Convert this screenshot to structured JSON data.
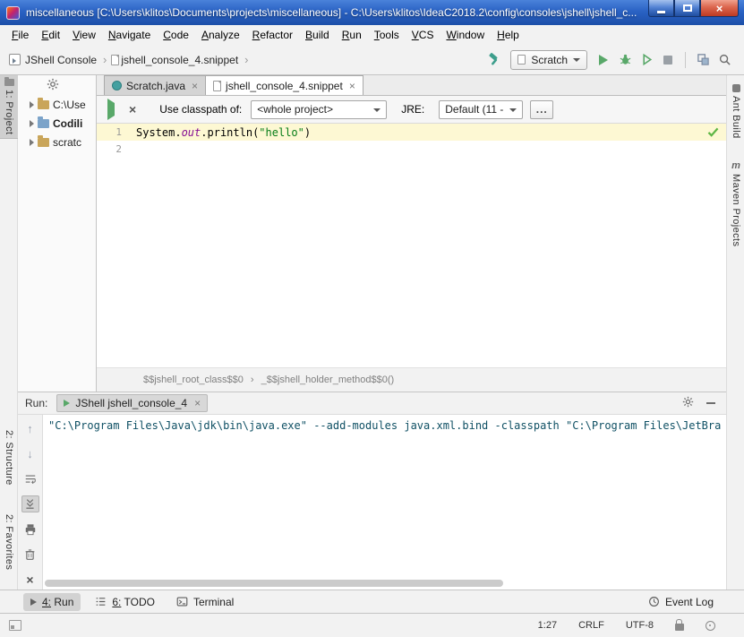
{
  "window": {
    "title": "miscellaneous [C:\\Users\\klitos\\Documents\\projects\\miscellaneous] - C:\\Users\\klitos\\IdeaC2018.2\\config\\consoles\\jshell\\jshell_c..."
  },
  "menu": {
    "items": [
      "File",
      "Edit",
      "View",
      "Navigate",
      "Code",
      "Analyze",
      "Refactor",
      "Build",
      "Run",
      "Tools",
      "VCS",
      "Window",
      "Help"
    ]
  },
  "navbar": {
    "breadcrumb": [
      "JShell Console",
      "jshell_console_4.snippet"
    ],
    "separator": "›",
    "run_config": "Scratch"
  },
  "stripes": {
    "project": "1: Project",
    "structure": "2: Structure",
    "favorites": "2: Favorites",
    "ant": "Ant Build",
    "maven": "Maven Projects"
  },
  "project_tree": {
    "items": [
      "C:\\Use",
      "Codili",
      "scratc"
    ]
  },
  "editor_tabs": {
    "tab1": "Scratch.java",
    "tab2": "jshell_console_4.snippet"
  },
  "jshell_bar": {
    "classpath_label": "Use classpath of:",
    "classpath_value": "<whole project>",
    "jre_label": "JRE:",
    "jre_value": "Default (11 -",
    "more": "..."
  },
  "editor": {
    "line_numbers": [
      "1",
      "2"
    ],
    "code": {
      "p0": "System.",
      "p1": "out",
      "p2": ".println(",
      "p3": "\"hello\"",
      "p4": ")"
    },
    "breadcrumb": [
      "$$jshell_root_class$$0",
      "_$$jshell_holder_method$$0()"
    ],
    "breadcrumb_sep": "›"
  },
  "run": {
    "label": "Run:",
    "tab": "JShell jshell_console_4",
    "console_line": "\"C:\\Program Files\\Java\\jdk\\bin\\java.exe\" --add-modules java.xml.bind -classpath \"C:\\Program Files\\JetBra"
  },
  "bottom_bar": {
    "run_tab": "4: Run",
    "todo_tab": "6: TODO",
    "terminal_tab": "Terminal",
    "event_log": "Event Log"
  },
  "status_bar": {
    "caret": "1:27",
    "line_sep": "CRLF",
    "encoding": "UTF-8"
  },
  "icons": {
    "close_glyph": "×",
    "up_arrow": "↑",
    "down_arrow": "↓",
    "maven_glyph": "m"
  },
  "colors": {
    "accent_green": "#59a869",
    "titlebar_blue": "#2a62c4",
    "string_green": "#067d17",
    "field_purple": "#871094",
    "console_text": "#0f5064",
    "caret_row": "#fdf8d3"
  }
}
